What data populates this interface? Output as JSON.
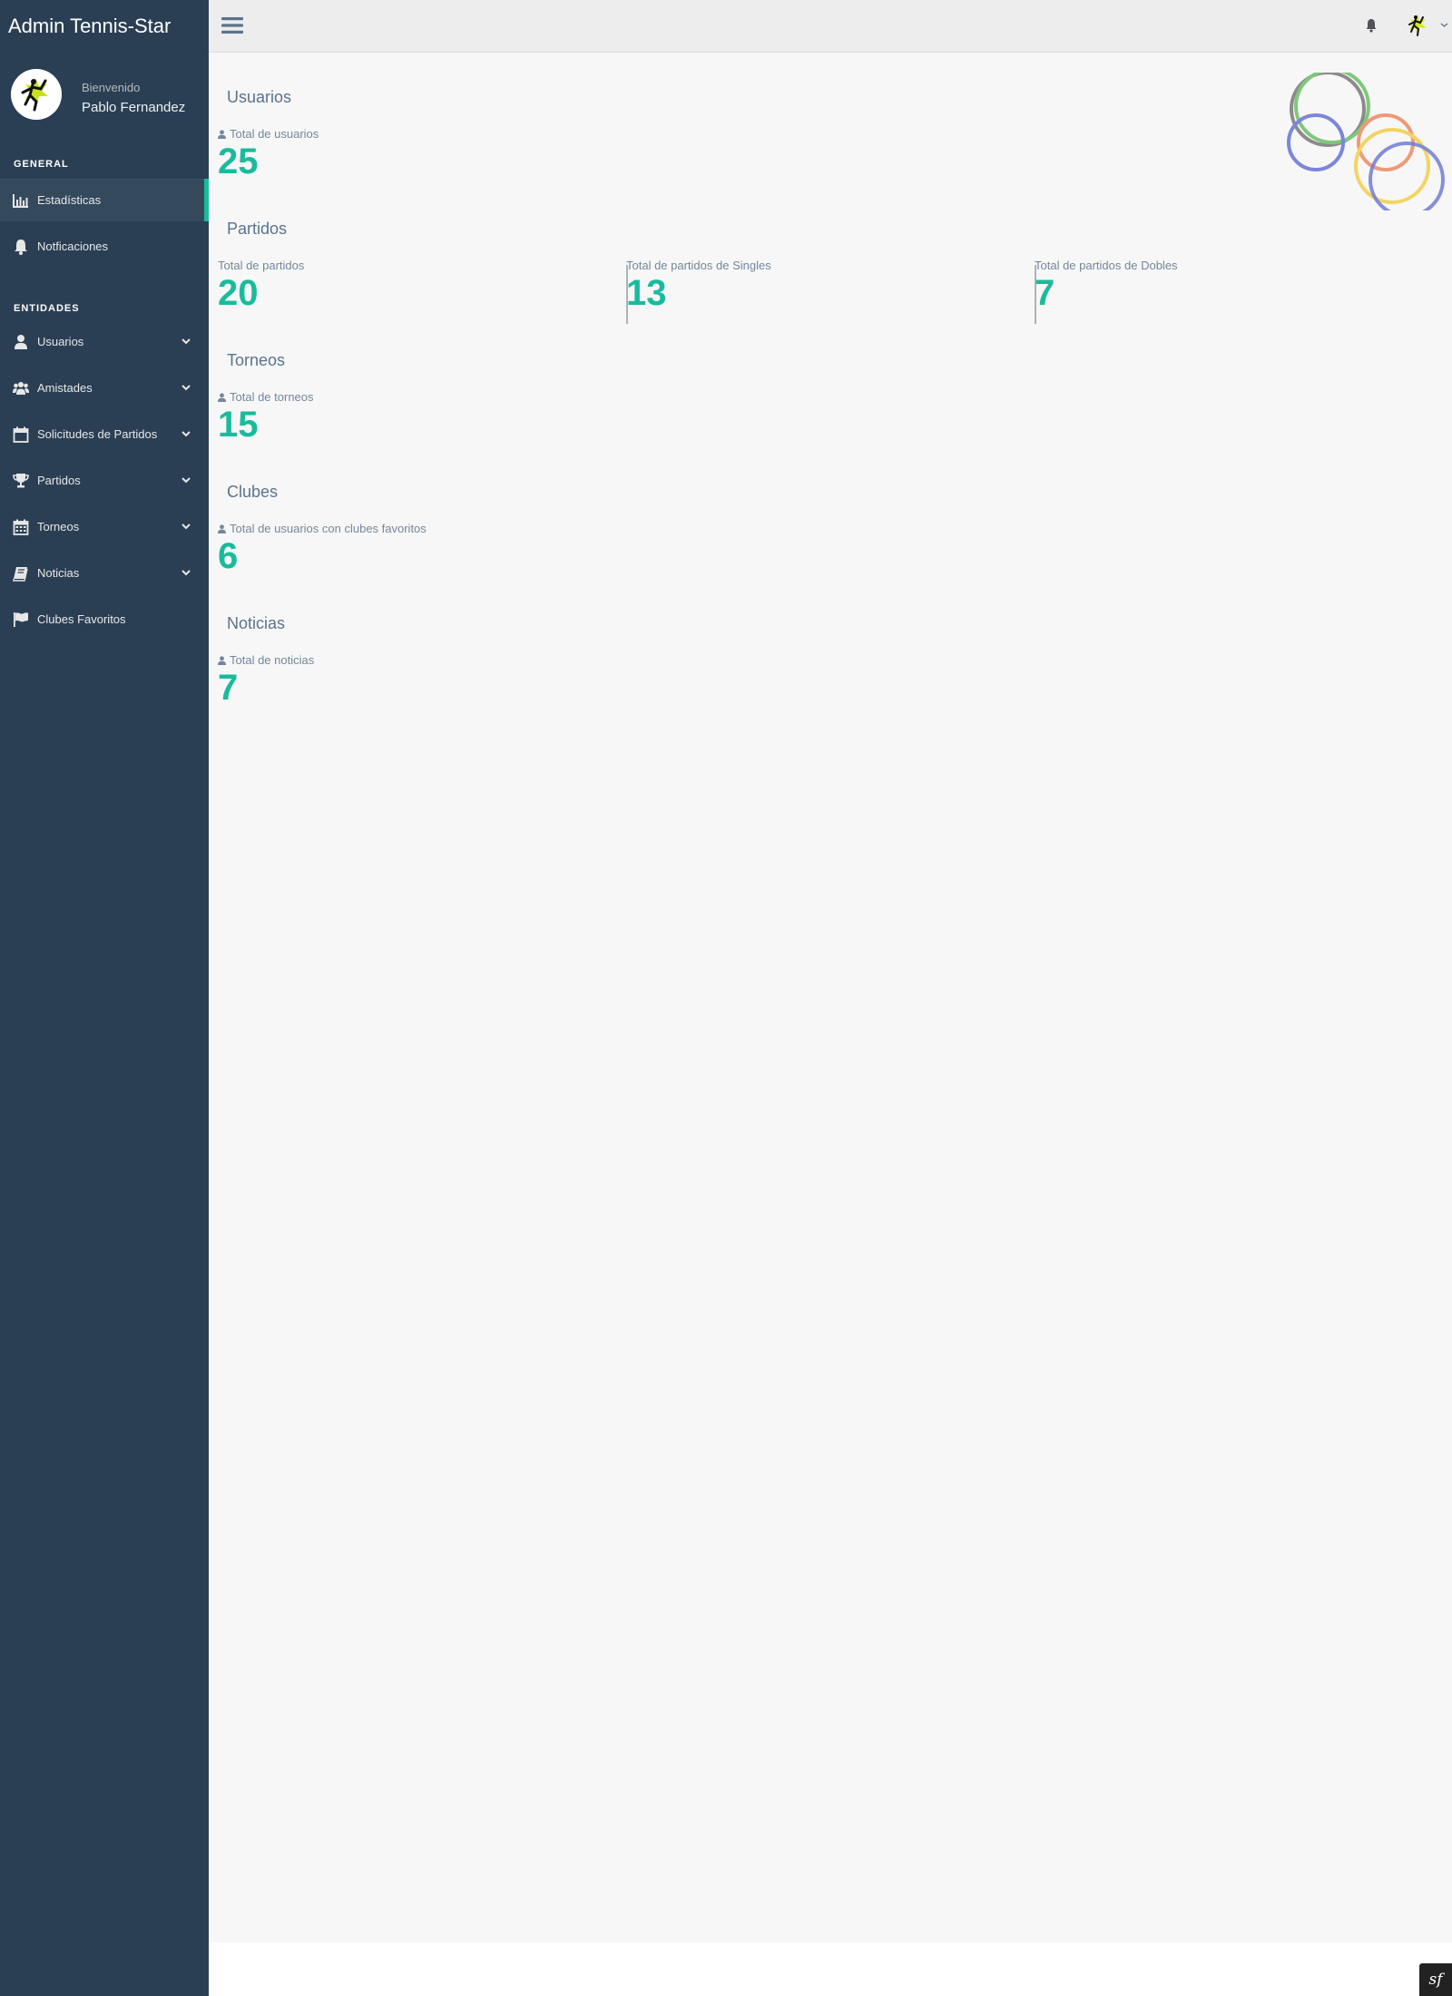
{
  "brand": "Admin Tennis-Star",
  "profile": {
    "welcome": "Bienvenido",
    "name": "Pablo Fernandez"
  },
  "sidebar": {
    "general_title": "GENERAL",
    "general_items": [
      {
        "label": "Estadísticas",
        "icon": "bar-chart-icon",
        "active": true
      },
      {
        "label": "Notficaciones",
        "icon": "bell-icon"
      }
    ],
    "entidades_title": "ENTIDADES",
    "entidades_items": [
      {
        "label": "Usuarios",
        "icon": "user-icon",
        "has_submenu": true
      },
      {
        "label": "Amistades",
        "icon": "users-icon",
        "has_submenu": true
      },
      {
        "label": "Solicitudes de Partidos",
        "icon": "calendar-icon",
        "has_submenu": true
      },
      {
        "label": "Partidos",
        "icon": "trophy-icon",
        "has_submenu": true
      },
      {
        "label": "Torneos",
        "icon": "calendar-grid-icon",
        "has_submenu": true
      },
      {
        "label": "Noticias",
        "icon": "book-icon",
        "has_submenu": true
      },
      {
        "label": "Clubes Favoritos",
        "icon": "flag-icon",
        "has_submenu": false
      }
    ]
  },
  "sections": {
    "usuarios": {
      "title": "Usuarios",
      "tiles": [
        {
          "caption": "Total de usuarios",
          "value": "25"
        }
      ]
    },
    "partidos": {
      "title": "Partidos",
      "tiles": [
        {
          "caption": "Total de partidos",
          "value": "20"
        },
        {
          "caption": "Total de partidos de Singles",
          "value": "13"
        },
        {
          "caption": "Total de partidos de Dobles",
          "value": "7"
        }
      ]
    },
    "torneos": {
      "title": "Torneos",
      "tiles": [
        {
          "caption": "Total de torneos",
          "value": "15"
        }
      ]
    },
    "clubes": {
      "title": "Clubes",
      "tiles": [
        {
          "caption": "Total de usuarios con clubes favoritos",
          "value": "6"
        }
      ]
    },
    "noticias": {
      "title": "Noticias",
      "tiles": [
        {
          "caption": "Total de noticias",
          "value": "7"
        }
      ]
    }
  },
  "colors": {
    "sidebar": "#2a3f54",
    "accent": "#1abb9c",
    "page_bg": "#f7f7f7",
    "heading": "#5a738e"
  },
  "footer": {
    "badge": "sf"
  }
}
